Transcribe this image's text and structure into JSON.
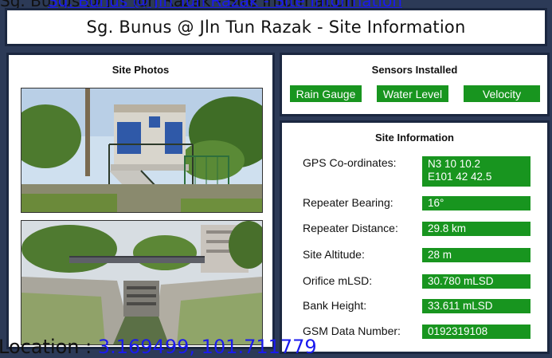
{
  "title": "Sg. Bunus @ Jln Tun Razak - Site Information",
  "photos": {
    "heading": "Site Photos"
  },
  "sensors": {
    "heading": "Sensors Installed",
    "items": [
      "Rain Gauge",
      "Water Level",
      "Velocity"
    ]
  },
  "info": {
    "heading": "Site Information",
    "gps_label": "GPS Co-ordinates:",
    "gps_n": "N3 10 10.2",
    "gps_e": "E101 42 42.5",
    "rows": [
      {
        "label": "Repeater Bearing:",
        "value": "16°"
      },
      {
        "label": "Repeater Distance:",
        "value": "29.8 km"
      },
      {
        "label": "Site Altitude:",
        "value": "28 m"
      },
      {
        "label": "Orifice mLSD:",
        "value": "30.780 mLSD"
      },
      {
        "label": "Bank Height:",
        "value": "33.611 mLSD"
      },
      {
        "label": "GSM Data Number:",
        "value": "0192319108"
      }
    ]
  },
  "location": {
    "prefix": "Location : ",
    "value": "3.169499, 101.711779"
  },
  "colors": {
    "green": "#18951f",
    "frame": "#1b2740",
    "link": "#1a1aee"
  }
}
